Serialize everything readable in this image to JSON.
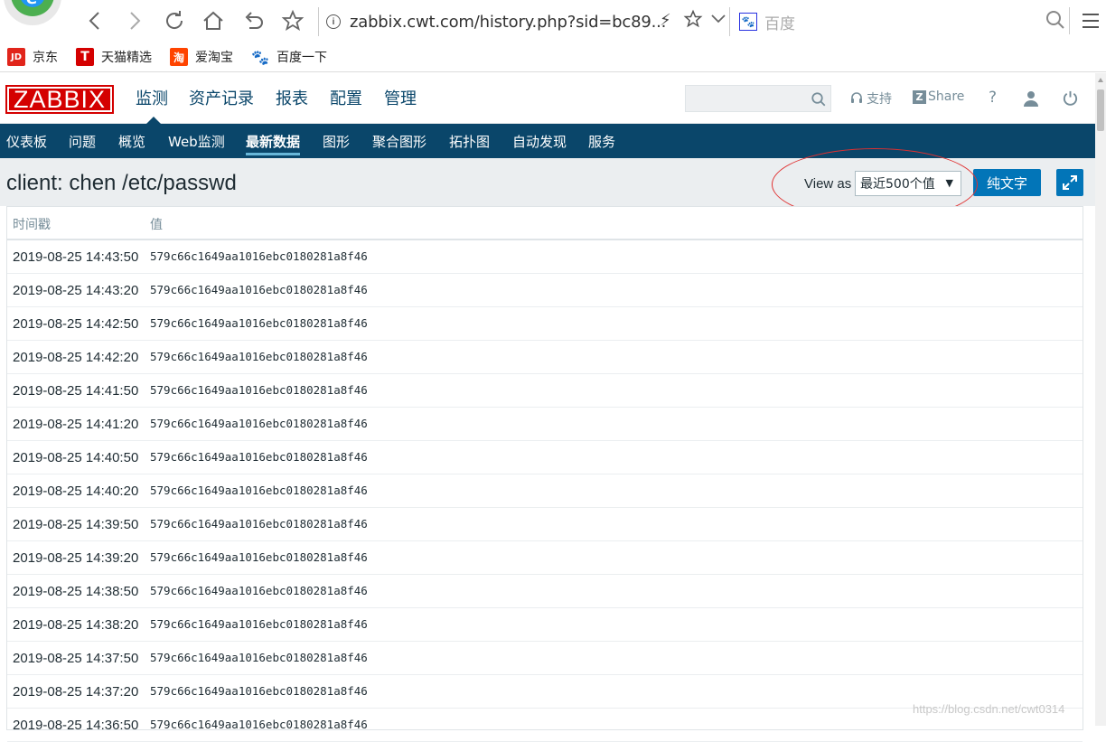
{
  "browser": {
    "url": "zabbix.cwt.com/history.php?sid=bc89...",
    "search_engine": "百度",
    "bookmarks": [
      {
        "label": "京东",
        "icon": "jd-icon",
        "badge": "JD",
        "color": "#e1251b"
      },
      {
        "label": "天猫精选",
        "icon": "tmall-icon",
        "badge": "T",
        "color": "#d40000"
      },
      {
        "label": "爱淘宝",
        "icon": "taobao-icon",
        "badge": "淘",
        "color": "#ff4400"
      },
      {
        "label": "百度一下",
        "icon": "baidu-paw-icon",
        "badge": "",
        "color": "#2932e1"
      }
    ]
  },
  "header": {
    "logo": "ZABBIX",
    "menu": [
      "监测",
      "资产记录",
      "报表",
      "配置",
      "管理"
    ],
    "active_menu": "监测",
    "support": "支持",
    "share": "Share",
    "help": "?"
  },
  "submenu": {
    "items": [
      "仪表板",
      "问题",
      "概览",
      "Web监测",
      "最新数据",
      "图形",
      "聚合图形",
      "拓扑图",
      "自动发现",
      "服务"
    ],
    "active": "最新数据"
  },
  "page": {
    "title": "client: chen /etc/passwd",
    "view_as_label": "View as",
    "view_as_value": "最近500个值",
    "plain_text_button": "纯文字"
  },
  "table": {
    "columns": [
      "时间戳",
      "值"
    ],
    "rows": [
      {
        "time": "2019-08-25 14:43:50",
        "value": "579c66c1649aa1016ebc0180281a8f46"
      },
      {
        "time": "2019-08-25 14:43:20",
        "value": "579c66c1649aa1016ebc0180281a8f46"
      },
      {
        "time": "2019-08-25 14:42:50",
        "value": "579c66c1649aa1016ebc0180281a8f46"
      },
      {
        "time": "2019-08-25 14:42:20",
        "value": "579c66c1649aa1016ebc0180281a8f46"
      },
      {
        "time": "2019-08-25 14:41:50",
        "value": "579c66c1649aa1016ebc0180281a8f46"
      },
      {
        "time": "2019-08-25 14:41:20",
        "value": "579c66c1649aa1016ebc0180281a8f46"
      },
      {
        "time": "2019-08-25 14:40:50",
        "value": "579c66c1649aa1016ebc0180281a8f46"
      },
      {
        "time": "2019-08-25 14:40:20",
        "value": "579c66c1649aa1016ebc0180281a8f46"
      },
      {
        "time": "2019-08-25 14:39:50",
        "value": "579c66c1649aa1016ebc0180281a8f46"
      },
      {
        "time": "2019-08-25 14:39:20",
        "value": "579c66c1649aa1016ebc0180281a8f46"
      },
      {
        "time": "2019-08-25 14:38:50",
        "value": "579c66c1649aa1016ebc0180281a8f46"
      },
      {
        "time": "2019-08-25 14:38:20",
        "value": "579c66c1649aa1016ebc0180281a8f46"
      },
      {
        "time": "2019-08-25 14:37:50",
        "value": "579c66c1649aa1016ebc0180281a8f46"
      },
      {
        "time": "2019-08-25 14:37:20",
        "value": "579c66c1649aa1016ebc0180281a8f46"
      },
      {
        "time": "2019-08-25 14:36:50",
        "value": "579c66c1649aa1016ebc0180281a8f46"
      }
    ]
  },
  "watermark": "https://blog.csdn.net/cwt0314"
}
